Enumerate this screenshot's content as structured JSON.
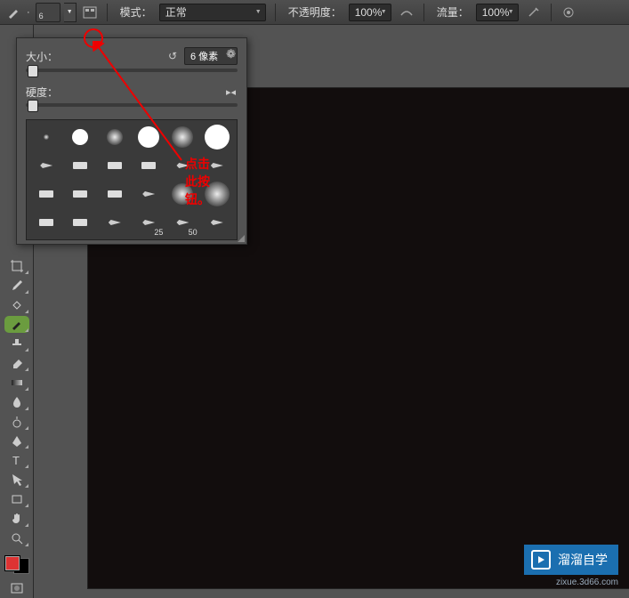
{
  "toolbar": {
    "brush_size_display": "6",
    "mode_label": "模式：",
    "mode_value": "正常",
    "opacity_label": "不透明度：",
    "opacity_value": "100%",
    "flow_label": "流量：",
    "flow_value": "100%"
  },
  "brush_panel": {
    "size_label": "大小：",
    "size_value": "6 像素",
    "hardness_label": "硬度：",
    "preset_sizes": [
      "25",
      "50"
    ]
  },
  "annotation": {
    "text": "点击此按钮。"
  },
  "watermark": {
    "brand": "溜溜自学",
    "url": "zixue.3d66.com"
  }
}
